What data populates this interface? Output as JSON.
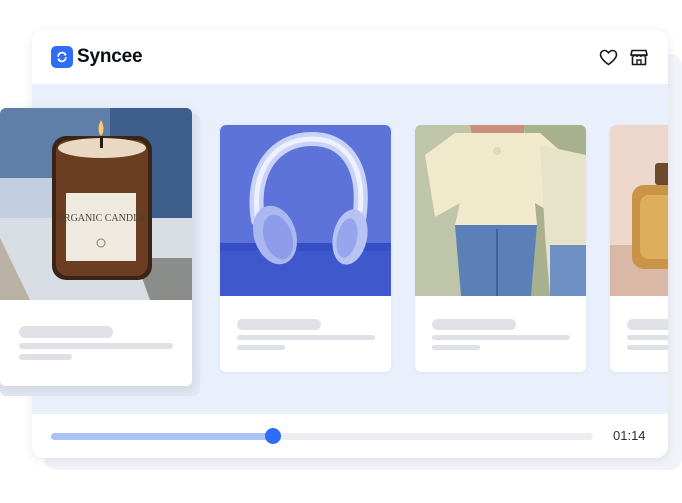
{
  "app": {
    "name": "Syncee"
  },
  "header": {
    "icons": [
      "heart-icon",
      "store-icon"
    ]
  },
  "cards": [
    {
      "product": "candle",
      "label": "ORGANIC CANDLE"
    },
    {
      "product": "headphones"
    },
    {
      "product": "blouse"
    },
    {
      "product": "perfume"
    }
  ],
  "player": {
    "time": "01:14",
    "progress": 0.41
  },
  "colors": {
    "accent": "#2f6df6",
    "progress_fill": "#a9c3f5",
    "stage_bg": "#eaf0fb"
  }
}
